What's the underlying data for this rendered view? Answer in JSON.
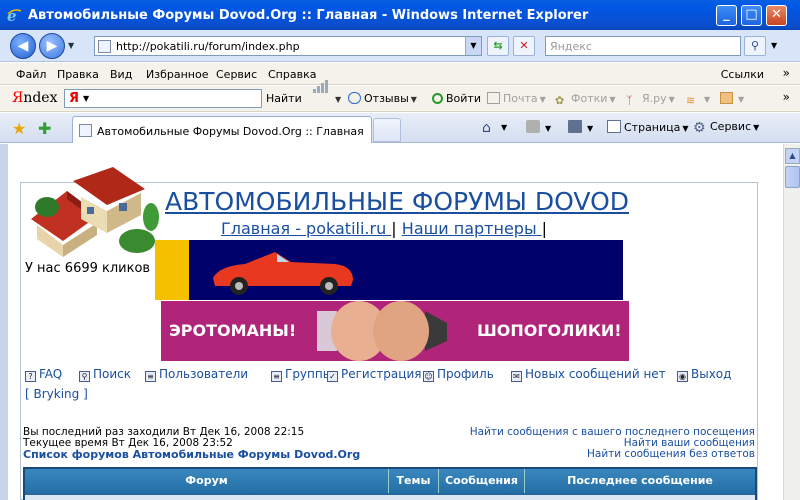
{
  "window": {
    "title": "Автомобильные Форумы Dovod.Org :: Главная - Windows Internet Explorer",
    "minimize": "_",
    "maximize": "□",
    "close": "✕"
  },
  "address_bar": {
    "url": "http://pokatili.ru/forum/index.php",
    "search_placeholder": "Яндекс"
  },
  "menu": {
    "items": [
      "Файл",
      "Правка",
      "Вид",
      "Избранное",
      "Сервис",
      "Справка"
    ],
    "links_label": "Ссылки"
  },
  "yandex_bar": {
    "logo_prefix": "Я",
    "logo_rest": "ndex",
    "input_prefix": "Я",
    "find": "Найти",
    "reviews": "Отзывы",
    "login": "Войти",
    "mail": "Почта",
    "photos": "Фотки",
    "yaru": "Я.ру"
  },
  "tabs": {
    "active_tab_title": "Автомобильные Форумы Dovod.Org :: Главная",
    "page_label": "Страница",
    "tools_label": "Сервис"
  },
  "page": {
    "site_title": "АВТОМОБИЛЬНЫЕ ФОРУМЫ DOVOD",
    "home_link": "Главная - pokatili.ru ",
    "partners_link": "Наши партнеры ",
    "separator": "|",
    "clicks_text": "У нас 6699 кликов",
    "banner2_left": "ЭРОТОМАНЫ!",
    "banner2_right": "ШОПОГОЛИКИ!",
    "nav": {
      "faq": "FAQ",
      "search": "Поиск",
      "users": "Пользователи",
      "groups": "Группы",
      "register": "Регистрация",
      "profile": "Профиль",
      "no_new_messages": "Новых сообщений нет",
      "logout": "Выход",
      "username": "[ Bryking ]"
    },
    "last_visit": "Вы последний раз заходили Вт Дек 16, 2008 22:15",
    "current_time": "Текущее время Вт Дек 16, 2008 23:52",
    "forum_list_title": "Список форумов Автомобильные Форумы Dovod.Org",
    "right_links": [
      "Найти сообщения с вашего последнего посещения",
      "Найти ваши сообщения",
      "Найти сообщения без ответов"
    ],
    "table_headers": {
      "forum": "Форум",
      "topics": "Темы",
      "posts": "Сообщения",
      "last_post": "Последнее сообщение"
    }
  },
  "colors": {
    "link_blue": "#1a4fa0",
    "table_header": "#246ea4",
    "banner_navy": "#00006a",
    "banner_magenta": "#b0247a"
  }
}
